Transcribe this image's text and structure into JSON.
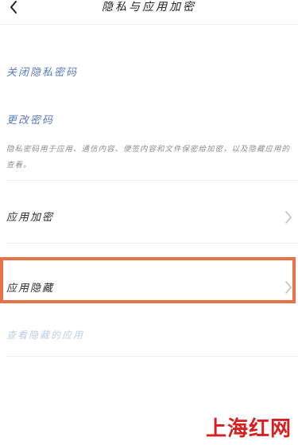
{
  "header": {
    "title": "隐私与应用加密",
    "back_icon": "chevron-left-icon"
  },
  "items": {
    "close_password": "关闭隐私密码",
    "change_password": "更改密码",
    "description": "隐私密码用于应用、通信内容、便签内容和文件保密给加密，以及隐藏应用的查看。",
    "app_encryption": "应用加密",
    "app_hide": "应用隐藏",
    "view_hidden_apps": "查看隐藏的应用"
  },
  "watermark": "上海红网",
  "colors": {
    "link": "#5a7cba",
    "highlight_border": "#e8724a",
    "watermark": "#d81e1e",
    "disabled_text": "#c2cde3"
  }
}
